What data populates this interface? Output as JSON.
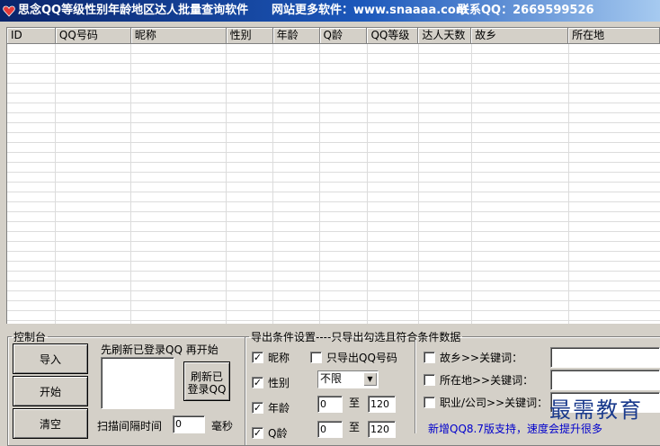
{
  "window": {
    "title": "思念QQ等级性别年龄地区达人批量查询软件",
    "website": "网站更多软件：www.snaaaa.com",
    "contact": "联系QQ：2669599526",
    "title_bar_color": "#0a246a"
  },
  "grid": {
    "columns": [
      "ID",
      "QQ号码",
      "昵称",
      "性别",
      "年龄",
      "Q龄",
      "QQ等级",
      "达人天数",
      "故乡",
      "所在地"
    ]
  },
  "control_panel": {
    "legend": "控制台",
    "import_label": "导入",
    "start_label": "开始",
    "clear_label": "清空",
    "hint": "先刷新已登录QQ 再开始",
    "refresh_label_line1": "刷新已",
    "refresh_label_line2": "登录QQ",
    "interval_label": "扫描间隔时间",
    "interval_value": "0",
    "interval_unit": "毫秒"
  },
  "export_panel": {
    "legend": "导出条件设置----只导出勾选且符合条件数据",
    "nickname": {
      "label": "昵称",
      "checked": true
    },
    "only_qq": {
      "label": "只导出QQ号码",
      "checked": false
    },
    "gender": {
      "label": "性别",
      "checked": true,
      "selected": "不限"
    },
    "age": {
      "label": "年龄",
      "checked": true,
      "from": "0",
      "to_label": "至",
      "to": "120"
    },
    "qage": {
      "label": "Q龄",
      "checked": true,
      "from": "0",
      "to_label": "至",
      "to": "120"
    },
    "hometown": {
      "label": "故乡>>关键词：",
      "checked": false,
      "value": ""
    },
    "location": {
      "label": "所在地>>关键词：",
      "checked": false,
      "value": ""
    },
    "job": {
      "label": "职业/公司>>关键词：",
      "checked": false,
      "value": ""
    },
    "notice": "新增QQ8.7版支持，速度会提升很多"
  },
  "watermark": "最需教育",
  "check_mark": "✓"
}
